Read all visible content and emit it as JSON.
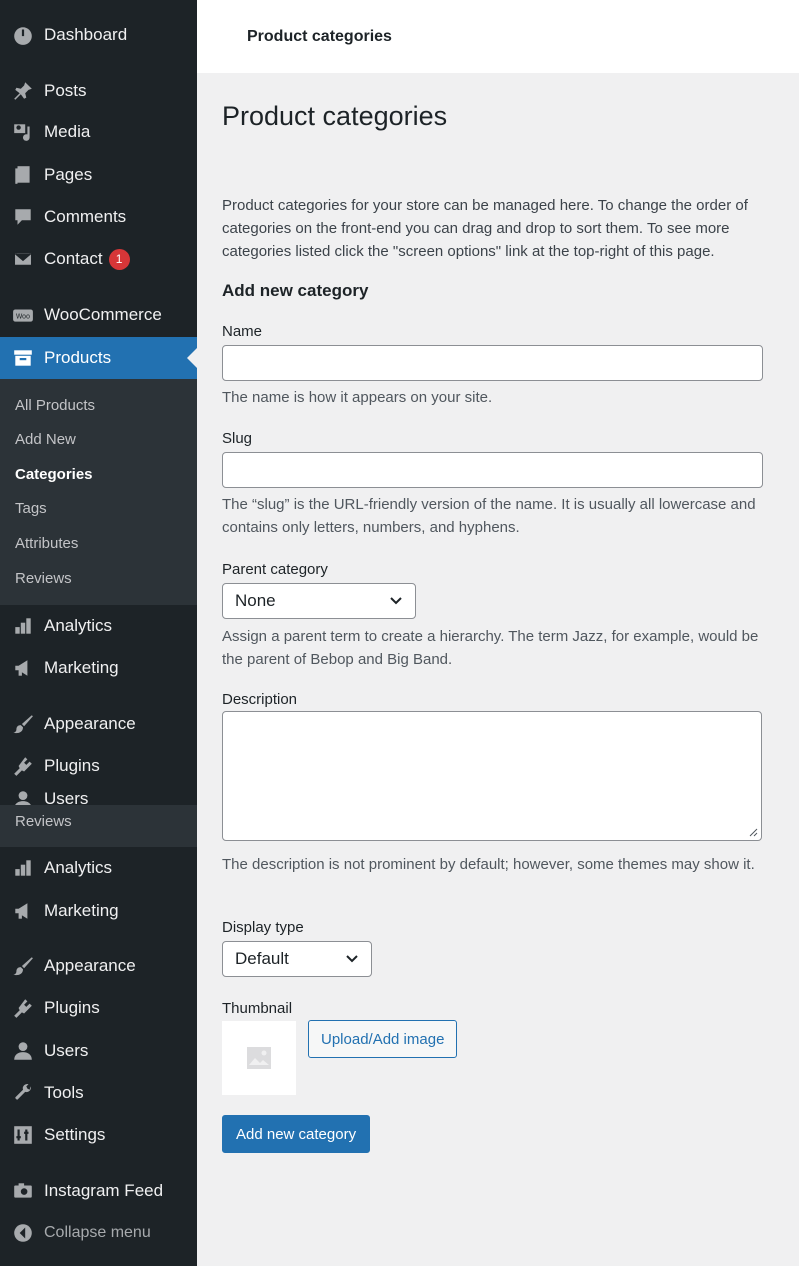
{
  "sidebar": {
    "dashboard": "Dashboard",
    "posts": "Posts",
    "media": "Media",
    "pages": "Pages",
    "comments": "Comments",
    "contact": "Contact",
    "contact_badge": "1",
    "woocommerce": "WooCommerce",
    "products": "Products",
    "submenu": [
      "All Products",
      "Add New",
      "Categories",
      "Tags",
      "Attributes",
      "Reviews"
    ],
    "analytics": "Analytics",
    "marketing": "Marketing",
    "appearance": "Appearance",
    "plugins": "Plugins",
    "users_partial": "Users",
    "reviews_dup": "Reviews",
    "analytics2": "Analytics",
    "marketing2": "Marketing",
    "appearance2": "Appearance",
    "plugins2": "Plugins",
    "users": "Users",
    "tools": "Tools",
    "settings": "Settings",
    "instagram": "Instagram Feed",
    "collapse": "Collapse menu"
  },
  "header": {
    "breadcrumb": "Product categories"
  },
  "main": {
    "title": "Product categories",
    "intro": "Product categories for your store can be managed here. To change the order of categories on the front-end you can drag and drop to sort them. To see more categories listed click the \"screen options\" link at the top-right of this page.",
    "form_title": "Add new category",
    "name_label": "Name",
    "name_value": "",
    "name_help": "The name is how it appears on your site.",
    "slug_label": "Slug",
    "slug_value": "",
    "slug_help": "The “slug” is the URL-friendly version of the name. It is usually all lowercase and contains only letters, numbers, and hyphens.",
    "parent_label": "Parent category",
    "parent_value": "None",
    "parent_help": "Assign a parent term to create a hierarchy. The term Jazz, for example, would be the parent of Bebop and Big Band.",
    "description_label": "Description",
    "description_help": "The description is not prominent by default; however, some themes may show it.",
    "display_label": "Display type",
    "display_value": "Default",
    "thumbnail_label": "Thumbnail",
    "upload_button": "Upload/Add image",
    "submit_button": "Add new category"
  },
  "colors": {
    "sidebar_bg": "#1d2327",
    "accent": "#2271b1",
    "badge": "#d63638",
    "page_bg": "#f0f0f1"
  }
}
